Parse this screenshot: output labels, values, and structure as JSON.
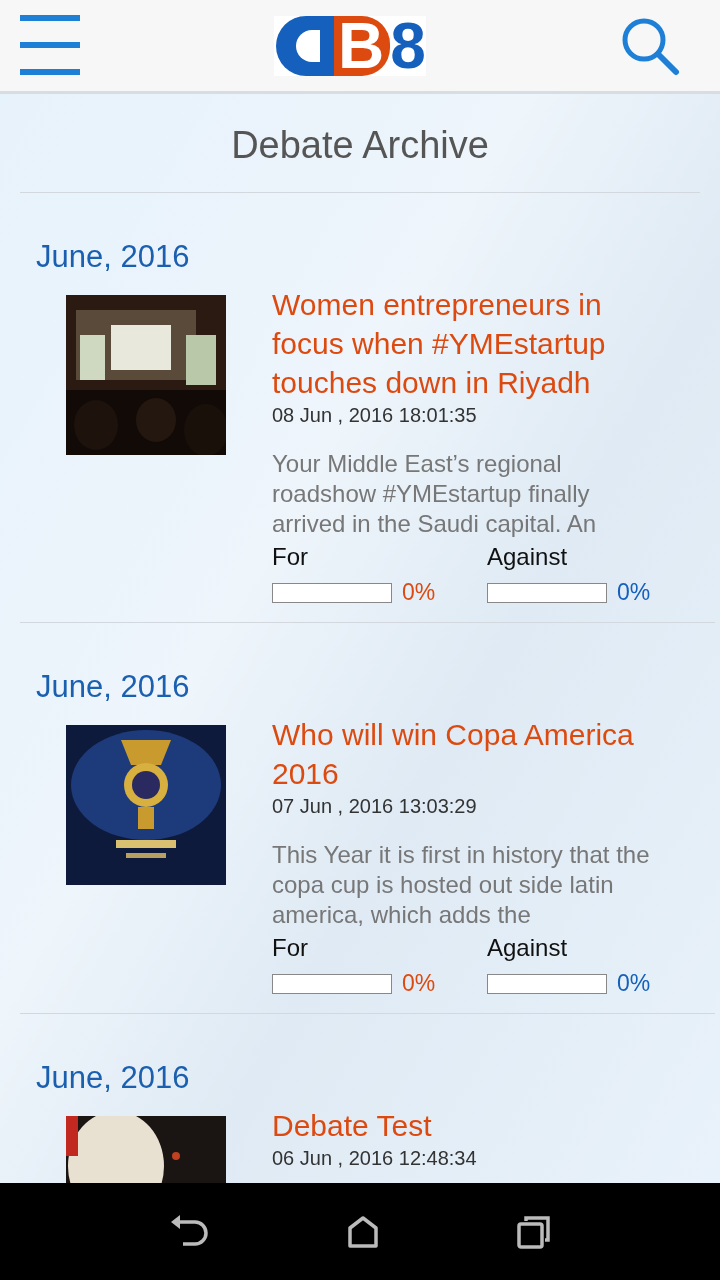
{
  "header": {
    "logo": [
      {
        "text": "B",
        "kind": "block"
      },
      {
        "text": "8",
        "kind": "plain"
      }
    ]
  },
  "page_title": "Debate Archive",
  "debates": [
    {
      "month": "June, 2016",
      "title": "Women entrepreneurs in focus when #YMEstartup touches down in Riyadh",
      "date": "08 Jun , 2016 18:01:35",
      "excerpt": "Your Middle East’s regional roadshow #YMEstartup finally arrived in the Saudi capital. An",
      "for": {
        "label": "For",
        "level": 0,
        "reading": "0%"
      },
      "against": {
        "label": "Against",
        "level": 0,
        "reading": "0%"
      }
    },
    {
      "month": "June, 2016",
      "title": "Who will win Copa America 2016",
      "date": "07 Jun , 2016 13:03:29",
      "excerpt": "This Year it is first in history that the copa cup is hosted out side latin america, which adds the",
      "for": {
        "label": "For",
        "level": 0,
        "reading": "0%"
      },
      "against": {
        "label": "Against",
        "level": 0,
        "reading": "0%"
      }
    },
    {
      "month": "June, 2016",
      "title": "Debate Test",
      "date": "06 Jun , 2016 12:48:34"
    }
  ]
}
